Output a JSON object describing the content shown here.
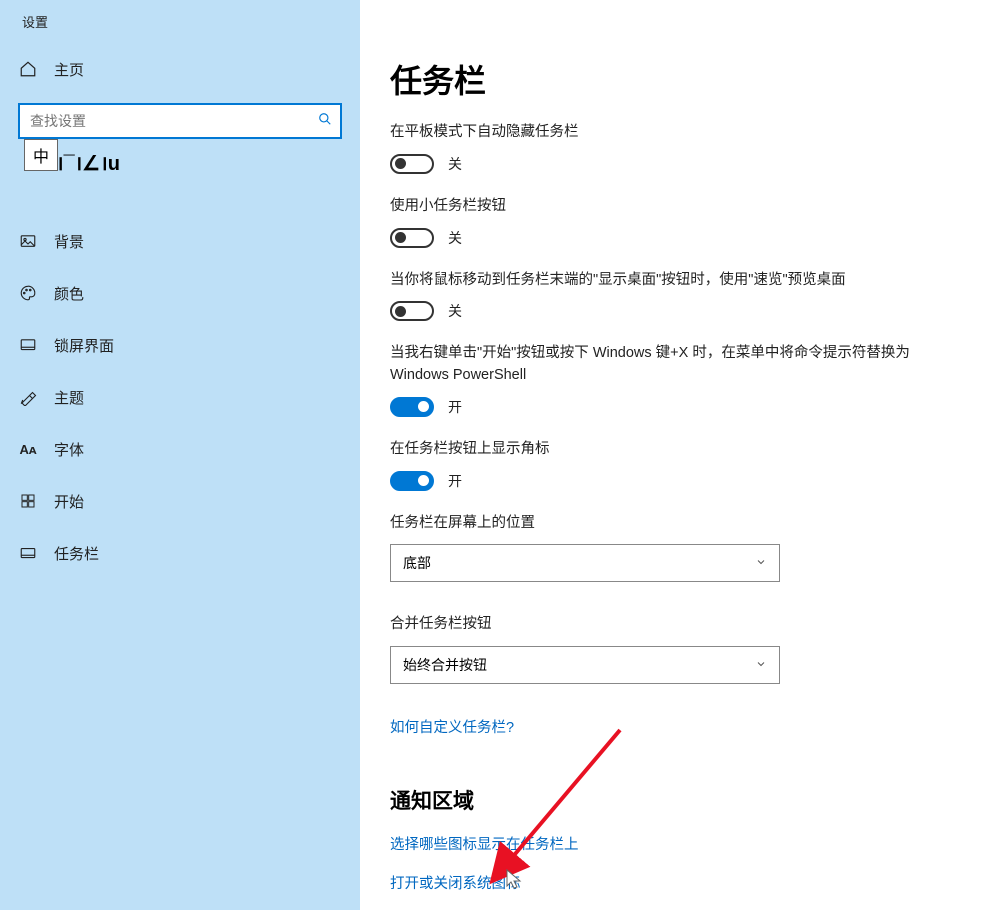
{
  "window": {
    "title": "设置"
  },
  "sidebar": {
    "home_label": "主页",
    "search_placeholder": "查找设置",
    "ime_badge": "中",
    "obscured_text": "।¯।∠।u",
    "items": [
      {
        "label": "背景",
        "icon": "picture-icon"
      },
      {
        "label": "颜色",
        "icon": "palette-icon"
      },
      {
        "label": "锁屏界面",
        "icon": "lockscreen-icon"
      },
      {
        "label": "主题",
        "icon": "theme-icon"
      },
      {
        "label": "字体",
        "icon": "font-icon"
      },
      {
        "label": "开始",
        "icon": "start-icon"
      },
      {
        "label": "任务栏",
        "icon": "taskbar-icon"
      }
    ]
  },
  "main": {
    "heading": "任务栏",
    "settings": [
      {
        "label": "在平板模式下自动隐藏任务栏",
        "state": "关",
        "on": false
      },
      {
        "label": "使用小任务栏按钮",
        "state": "关",
        "on": false
      },
      {
        "label": "当你将鼠标移动到任务栏末端的\"显示桌面\"按钮时，使用\"速览\"预览桌面",
        "state": "关",
        "on": false
      },
      {
        "label": "当我右键单击\"开始\"按钮或按下 Windows 键+X 时，在菜单中将命令提示符替换为 Windows PowerShell",
        "state": "开",
        "on": true
      },
      {
        "label": "在任务栏按钮上显示角标",
        "state": "开",
        "on": true
      }
    ],
    "position": {
      "label": "任务栏在屏幕上的位置",
      "value": "底部"
    },
    "combine": {
      "label": "合并任务栏按钮",
      "value": "始终合并按钮"
    },
    "help_link": "如何自定义任务栏?",
    "section2": {
      "heading": "通知区域",
      "links": [
        "选择哪些图标显示在任务栏上",
        "打开或关闭系统图标"
      ]
    }
  }
}
